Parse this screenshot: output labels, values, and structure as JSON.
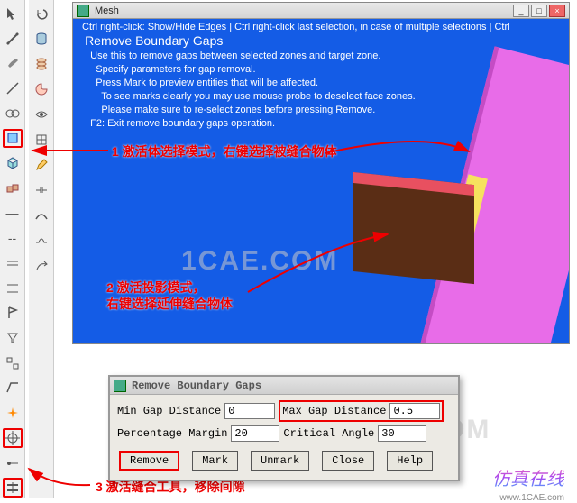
{
  "window": {
    "title": "Mesh",
    "hint_line": "Ctrl right-click: Show/Hide Edges | Ctrl right-click last selection, in case of multiple selections | Ctrl",
    "hint_title": "Remove Boundary Gaps",
    "hint1": "Use this to remove gaps between selected zones and target zone.",
    "hint2": "Specify parameters for gap removal.",
    "hint3": "Press Mark to preview entities that will be affected.",
    "hint4": "To see marks clearly you may use mouse probe to deselect face zones.",
    "hint5": "Please make sure to re-select zones before pressing Remove.",
    "hint6": "F2: Exit remove boundary gaps operation."
  },
  "annotations": {
    "a1": "1 激活体选择模式，右键选择被缝合物体",
    "a2": "2 激活投影模式，\n右键选择延伸缝合物体",
    "a3": "3 激活缝合工具，移除间隙"
  },
  "dialog": {
    "title": "Remove Boundary Gaps",
    "min_label": "Min Gap Distance",
    "min_value": "0",
    "max_label": "Max Gap Distance",
    "max_value": "0.5",
    "pm_label": "Percentage Margin",
    "pm_value": "20",
    "ca_label": "Critical Angle",
    "ca_value": "30",
    "btn_remove": "Remove",
    "btn_mark": "Mark",
    "btn_unmark": "Unmark",
    "btn_close": "Close",
    "btn_help": "Help"
  },
  "watermark": "1CAE.COM",
  "footer": "仿真在线",
  "footer2": "www.1CAE.com"
}
